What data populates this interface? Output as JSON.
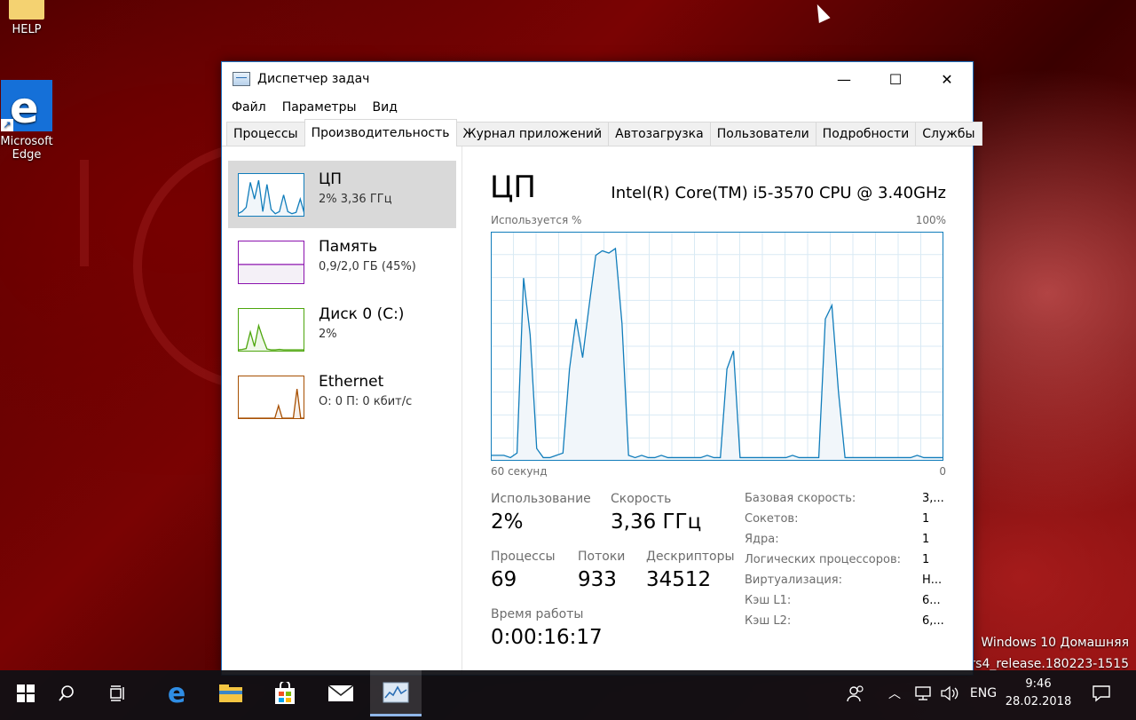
{
  "desktop": {
    "icons": [
      {
        "label": "HELP"
      },
      {
        "label_line1": "Microsoft",
        "label_line2": "Edge"
      }
    ],
    "watermark": {
      "line1": "Windows 10 Домашняя",
      "line2": "10.rs4_release.180223-1515"
    }
  },
  "window": {
    "title": "Диспетчер задач",
    "controls": {
      "minimize": "—",
      "maximize": "☐",
      "close": "✕"
    },
    "menu": [
      "Файл",
      "Параметры",
      "Вид"
    ],
    "tabs": [
      "Процессы",
      "Производительность",
      "Журнал приложений",
      "Автозагрузка",
      "Пользователи",
      "Подробности",
      "Службы"
    ],
    "active_tab": "Производительность",
    "sidebar": [
      {
        "name": "ЦП",
        "sub": "2% 3,36 ГГц",
        "color": "#117dbb",
        "fill": "#f1f6fa"
      },
      {
        "name": "Память",
        "sub": "0,9/2,0 ГБ (45%)",
        "color": "#8b12ae",
        "fill": "#f4f0f7"
      },
      {
        "name": "Диск 0 (C:)",
        "sub": "2%",
        "color": "#4da60c",
        "fill": "#eff7e9"
      },
      {
        "name": "Ethernet",
        "sub": "О: 0 П: 0 кбит/с",
        "color": "#a74f01",
        "fill": "#f7f0ea"
      }
    ],
    "main": {
      "title": "ЦП",
      "model": "Intel(R) Core(TM) i5-3570 CPU @ 3.40GHz",
      "graph_label_top_left": "Используется %",
      "graph_label_top_right": "100%",
      "graph_label_bottom_left": "60 секунд",
      "graph_label_bottom_right": "0",
      "graph_color": "#117dbb",
      "graph_fill": "#f1f6fa",
      "graph_grid": "#d9eaf4",
      "stats": {
        "usage_label": "Использование",
        "usage_value": "2%",
        "speed_label": "Скорость",
        "speed_value": "3,36 ГГц",
        "processes_label": "Процессы",
        "processes_value": "69",
        "threads_label": "Потоки",
        "threads_value": "933",
        "handles_label": "Дескрипторы",
        "handles_value": "34512",
        "uptime_label": "Время работы",
        "uptime_value": "0:00:16:17"
      },
      "specs": [
        {
          "label": "Базовая скорость:",
          "value": "3,..."
        },
        {
          "label": "Сокетов:",
          "value": "1"
        },
        {
          "label": "Ядра:",
          "value": "1"
        },
        {
          "label": "Логических процессоров:",
          "value": "1"
        },
        {
          "label": "Виртуализация:",
          "value": "Н..."
        },
        {
          "label": "Кэш L1:",
          "value": "6..."
        },
        {
          "label": "Кэш L2:",
          "value": "6,..."
        }
      ]
    }
  },
  "cpu_history": [
    2,
    2,
    2,
    1,
    3,
    80,
    55,
    5,
    1,
    1,
    2,
    3,
    40,
    62,
    45,
    68,
    90,
    92,
    91,
    93,
    60,
    2,
    1,
    2,
    1,
    1,
    2,
    1,
    1,
    1,
    1,
    1,
    1,
    2,
    1,
    1,
    40,
    48,
    1,
    1,
    1,
    1,
    1,
    1,
    1,
    1,
    2,
    1,
    1,
    1,
    1,
    62,
    68,
    30,
    1,
    1,
    1,
    1,
    1,
    1,
    1,
    1,
    1,
    1,
    1,
    2,
    1,
    1,
    1,
    1
  ],
  "thumb_history": {
    "cpu": [
      5,
      10,
      20,
      80,
      40,
      85,
      10,
      75,
      15,
      5,
      10,
      50,
      10,
      5,
      8,
      40,
      5
    ],
    "memory": [
      45,
      45,
      45,
      45,
      45,
      45,
      45,
      45,
      45,
      45,
      45,
      45,
      45,
      45,
      45,
      45,
      45
    ],
    "disk": [
      2,
      3,
      5,
      45,
      10,
      60,
      30,
      4,
      2,
      2,
      3,
      2,
      2,
      2,
      2,
      2,
      2
    ],
    "ethernet": [
      0,
      0,
      0,
      0,
      0,
      0,
      0,
      0,
      0,
      0,
      0,
      30,
      0,
      0,
      0,
      0,
      70,
      0,
      0
    ]
  },
  "taskbar": {
    "language": "ENG",
    "time": "9:46",
    "date": "28.02.2018"
  }
}
